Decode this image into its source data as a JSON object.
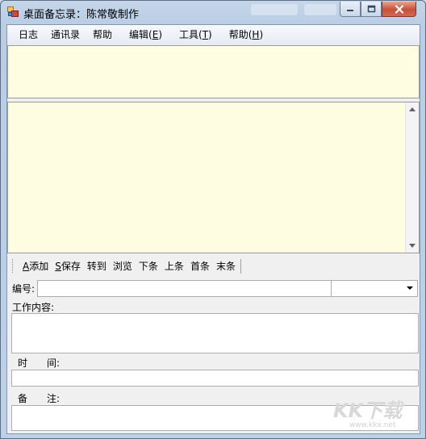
{
  "window": {
    "title": "桌面备忘录：陈常敬制作"
  },
  "menu": [
    {
      "label": "日志"
    },
    {
      "label": "通讯录"
    },
    {
      "label": "帮助"
    },
    {
      "label": "编辑(E)",
      "pre": "编辑(",
      "key": "E",
      "post": ")"
    },
    {
      "label": "工具(T)",
      "pre": "工具(",
      "key": "T",
      "post": ")"
    },
    {
      "label": "帮助(H)",
      "pre": "帮助(",
      "key": "H",
      "post": ")"
    }
  ],
  "toolbar": {
    "add": {
      "key": "A",
      "text": "添加"
    },
    "save": {
      "key": "S",
      "text": "保存"
    },
    "goto": "转到",
    "browse": "浏览",
    "next": "下条",
    "prev": "上条",
    "first": "首条",
    "last": "末条"
  },
  "form": {
    "id_label": "编号:",
    "id_value": "",
    "combo_value": "",
    "content_label": "工作内容:",
    "content_value": "",
    "time_label": "时　　间:",
    "time_value": "",
    "note_label": "备　　注:",
    "note_value": ""
  },
  "watermark": {
    "text": "KK下载",
    "url": "www.kkx.net"
  }
}
